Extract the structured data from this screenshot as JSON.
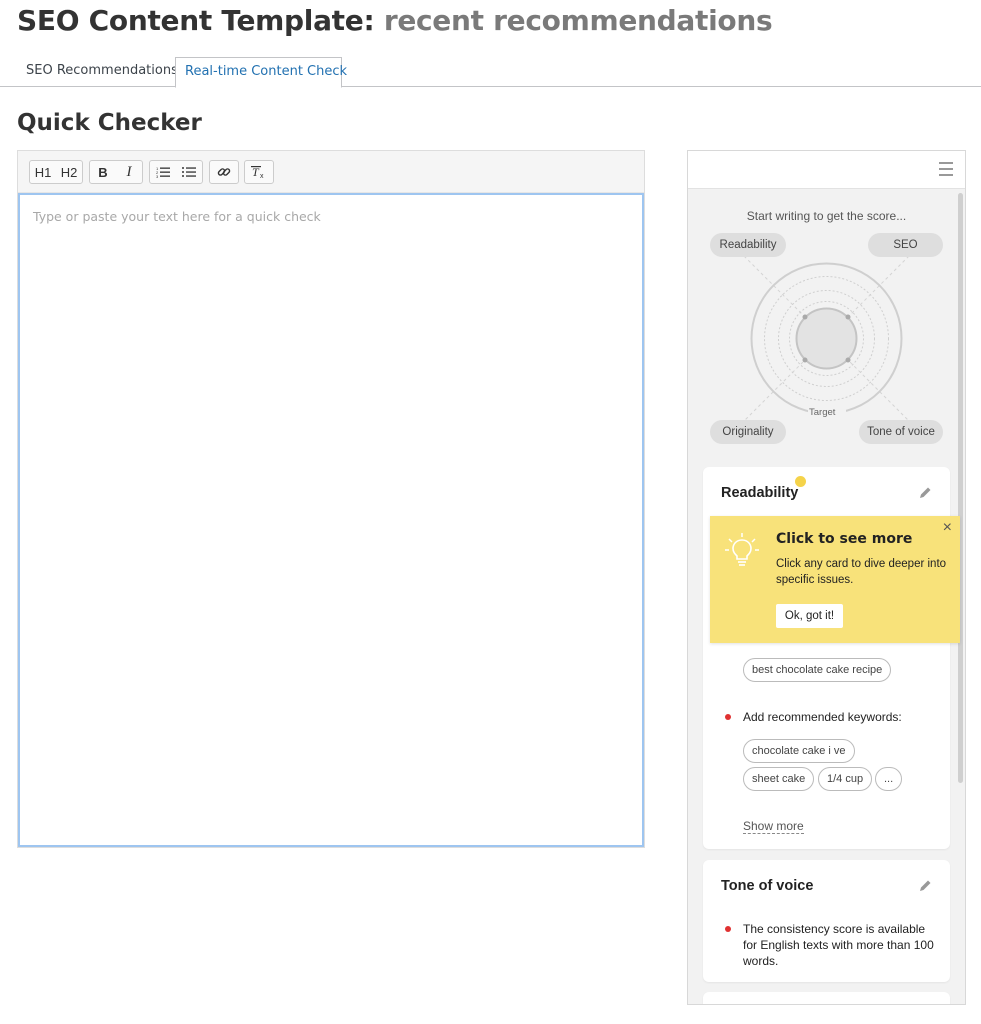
{
  "page": {
    "title_main": "SEO Content Template:",
    "title_sub": "recent recommendations"
  },
  "tabs": [
    {
      "label": "SEO Recommendations",
      "active": false
    },
    {
      "label": "Real-time Content Check",
      "active": true
    }
  ],
  "quick_checker": {
    "title": "Quick Checker",
    "toolbar": {
      "h1": "H1",
      "h2": "H2",
      "bold": "B",
      "italic": "I",
      "icons": [
        "ordered-list-icon",
        "unordered-list-icon",
        "link-icon",
        "clear-format-icon"
      ]
    },
    "editor_placeholder": "Type or paste your text here for a quick check"
  },
  "score_panel": {
    "caption": "Start writing to get the score...",
    "labels": {
      "readability": "Readability",
      "seo": "SEO",
      "originality": "Originality",
      "tone": "Tone of voice",
      "target": "Target"
    }
  },
  "cards": {
    "readability": {
      "title": "Readability",
      "target_keyword": "best chocolate cake recipe",
      "recommended_label": "Add recommended keywords:",
      "keywords": [
        "chocolate cake i ve",
        "sheet cake",
        "1/4 cup",
        "..."
      ],
      "show_more": "Show more"
    },
    "tone": {
      "title": "Tone of voice",
      "message": "The consistency score is available for English texts with more than 100 words."
    }
  },
  "tooltip": {
    "title": "Click to see more",
    "body": "Click any card to dive deeper into specific issues.",
    "button": "Ok, got it!",
    "close": "×"
  },
  "colors": {
    "active_tab": "#2271b1",
    "editor_focus_border": "#9ec5f0",
    "tooltip_bg": "#f8e27a",
    "issue_bullet": "#e03131",
    "notification_dot": "#f5d34a"
  }
}
